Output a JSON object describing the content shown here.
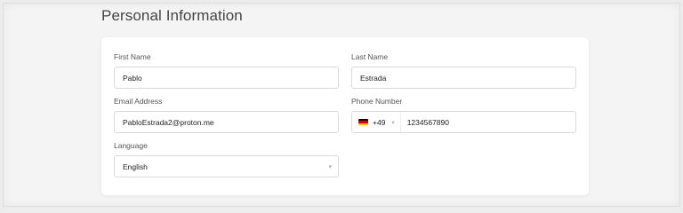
{
  "section": {
    "title": "Personal Information"
  },
  "form": {
    "first_name": {
      "label": "First Name",
      "value": "Pablo"
    },
    "last_name": {
      "label": "Last Name",
      "value": "Estrada"
    },
    "email": {
      "label": "Email Address",
      "value": "PabloEstrada2@proton.me"
    },
    "phone": {
      "label": "Phone Number",
      "country_flag": "germany-flag-icon",
      "dial_code": "+49",
      "value": "1234567890"
    },
    "language": {
      "label": "Language",
      "value": "English"
    }
  },
  "colors": {
    "flag_stripes": [
      "#000000",
      "#dd0000",
      "#ffce00"
    ],
    "border": "#d9d9d9"
  }
}
